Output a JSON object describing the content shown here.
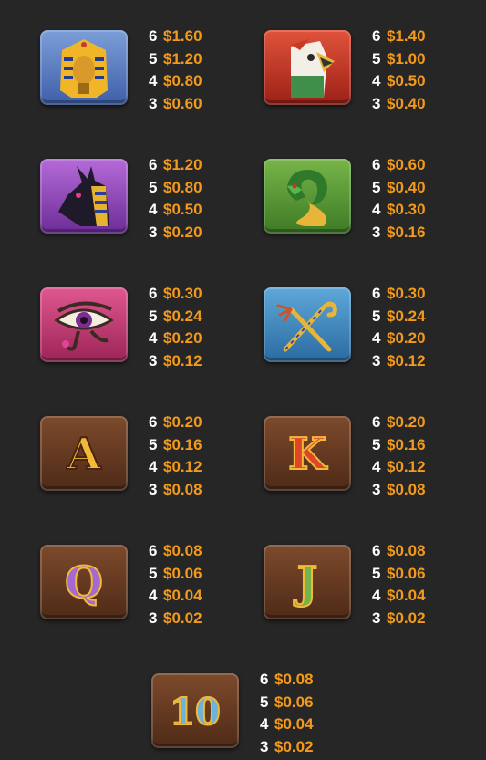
{
  "symbols": [
    {
      "name": "Pharaoh",
      "icon": "pharaoh-mask-icon",
      "pays": [
        {
          "count": "6",
          "amount": "$1.60"
        },
        {
          "count": "5",
          "amount": "$1.20"
        },
        {
          "count": "4",
          "amount": "$0.80"
        },
        {
          "count": "3",
          "amount": "$0.60"
        }
      ]
    },
    {
      "name": "Horus",
      "icon": "falcon-head-icon",
      "pays": [
        {
          "count": "6",
          "amount": "$1.40"
        },
        {
          "count": "5",
          "amount": "$1.00"
        },
        {
          "count": "4",
          "amount": "$0.50"
        },
        {
          "count": "3",
          "amount": "$0.40"
        }
      ]
    },
    {
      "name": "Anubis",
      "icon": "jackal-head-icon",
      "pays": [
        {
          "count": "6",
          "amount": "$1.20"
        },
        {
          "count": "5",
          "amount": "$0.80"
        },
        {
          "count": "4",
          "amount": "$0.50"
        },
        {
          "count": "3",
          "amount": "$0.20"
        }
      ]
    },
    {
      "name": "Cobra",
      "icon": "cobra-icon",
      "pays": [
        {
          "count": "6",
          "amount": "$0.60"
        },
        {
          "count": "5",
          "amount": "$0.40"
        },
        {
          "count": "4",
          "amount": "$0.30"
        },
        {
          "count": "3",
          "amount": "$0.16"
        }
      ]
    },
    {
      "name": "Eye of Ra",
      "icon": "eye-of-ra-icon",
      "pays": [
        {
          "count": "6",
          "amount": "$0.30"
        },
        {
          "count": "5",
          "amount": "$0.24"
        },
        {
          "count": "4",
          "amount": "$0.20"
        },
        {
          "count": "3",
          "amount": "$0.12"
        }
      ]
    },
    {
      "name": "Crook and Flail",
      "icon": "crook-and-flail-icon",
      "pays": [
        {
          "count": "6",
          "amount": "$0.30"
        },
        {
          "count": "5",
          "amount": "$0.24"
        },
        {
          "count": "4",
          "amount": "$0.20"
        },
        {
          "count": "3",
          "amount": "$0.12"
        }
      ]
    },
    {
      "name": "A",
      "glyph": "A",
      "icon": "letter-a-icon",
      "pays": [
        {
          "count": "6",
          "amount": "$0.20"
        },
        {
          "count": "5",
          "amount": "$0.16"
        },
        {
          "count": "4",
          "amount": "$0.12"
        },
        {
          "count": "3",
          "amount": "$0.08"
        }
      ]
    },
    {
      "name": "K",
      "glyph": "K",
      "icon": "letter-k-icon",
      "pays": [
        {
          "count": "6",
          "amount": "$0.20"
        },
        {
          "count": "5",
          "amount": "$0.16"
        },
        {
          "count": "4",
          "amount": "$0.12"
        },
        {
          "count": "3",
          "amount": "$0.08"
        }
      ]
    },
    {
      "name": "Q",
      "glyph": "Q",
      "icon": "letter-q-icon",
      "pays": [
        {
          "count": "6",
          "amount": "$0.08"
        },
        {
          "count": "5",
          "amount": "$0.06"
        },
        {
          "count": "4",
          "amount": "$0.04"
        },
        {
          "count": "3",
          "amount": "$0.02"
        }
      ]
    },
    {
      "name": "J",
      "glyph": "J",
      "icon": "letter-j-icon",
      "pays": [
        {
          "count": "6",
          "amount": "$0.08"
        },
        {
          "count": "5",
          "amount": "$0.06"
        },
        {
          "count": "4",
          "amount": "$0.04"
        },
        {
          "count": "3",
          "amount": "$0.02"
        }
      ]
    },
    {
      "name": "10",
      "glyph": "10",
      "icon": "number-ten-icon",
      "pays": [
        {
          "count": "6",
          "amount": "$0.08"
        },
        {
          "count": "5",
          "amount": "$0.06"
        },
        {
          "count": "4",
          "amount": "$0.04"
        },
        {
          "count": "3",
          "amount": "$0.02"
        }
      ]
    }
  ],
  "colors": {
    "background": "#262626",
    "amount": "#f39a1c",
    "count": "#ffffff"
  }
}
